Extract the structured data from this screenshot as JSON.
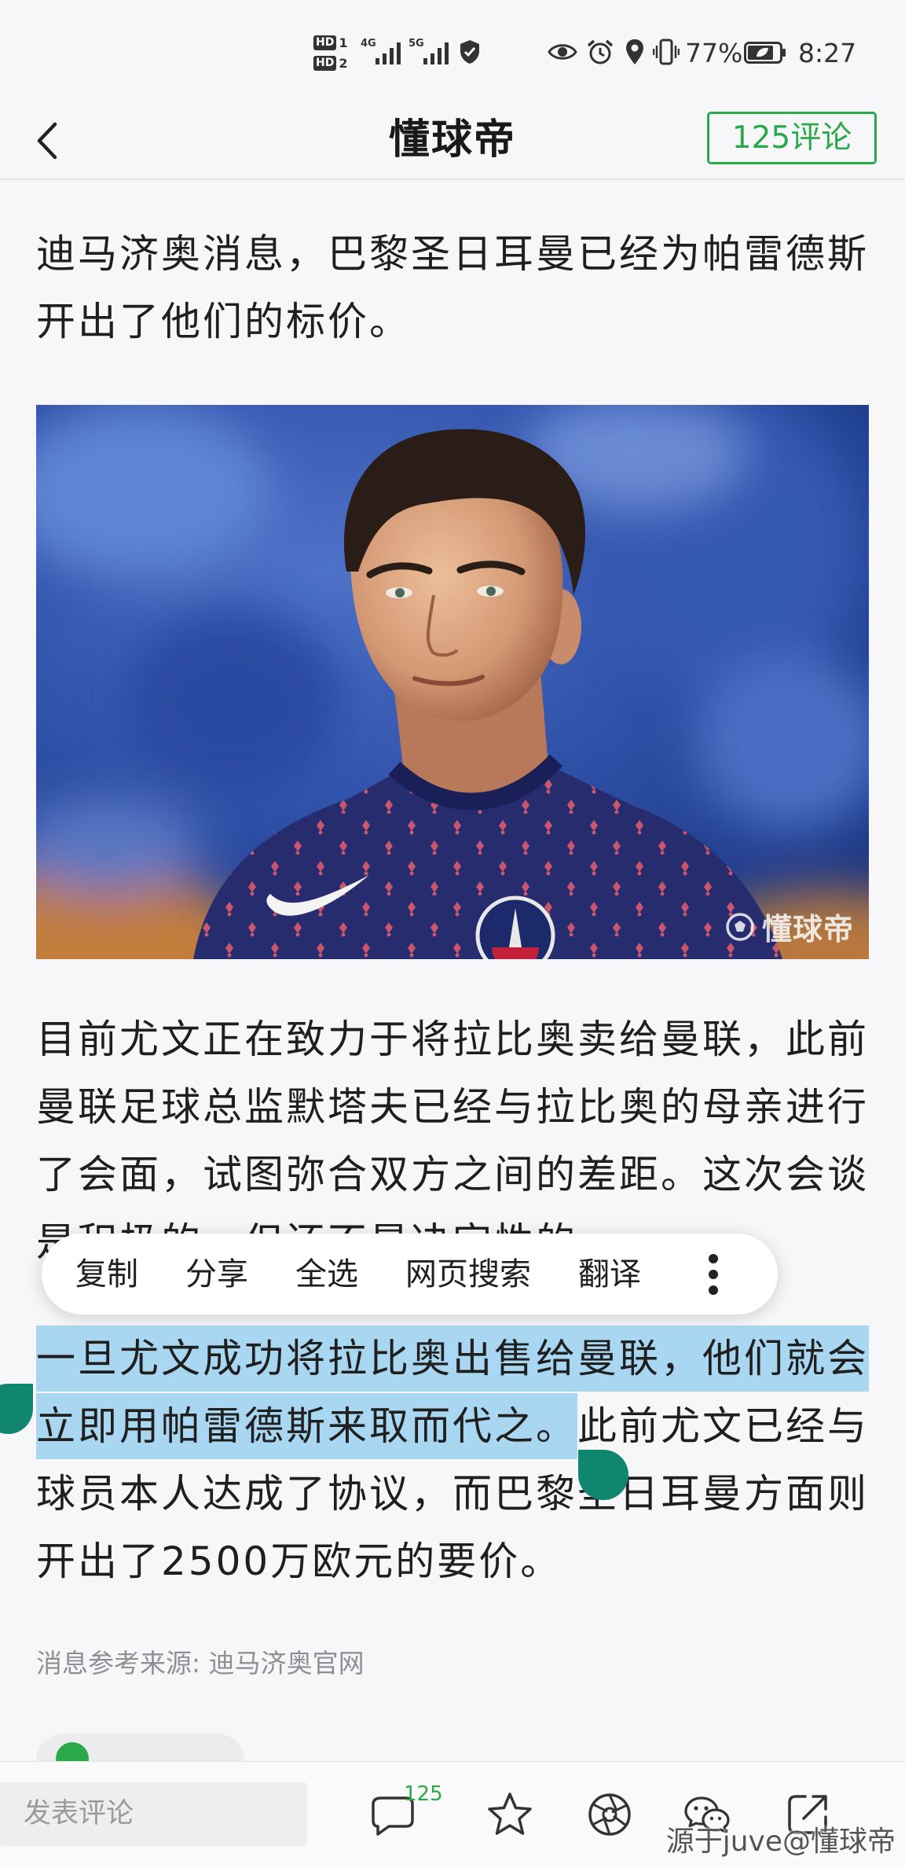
{
  "status_bar": {
    "sim_cards": [
      {
        "badge": "HD",
        "slot": "1"
      },
      {
        "badge": "HD",
        "slot": "2"
      }
    ],
    "networks": [
      "4G",
      "5G"
    ],
    "battery_percent": "77%",
    "time": "8:27",
    "icons": [
      "signal-4g-icon",
      "signal-5g-icon",
      "shield-check-icon",
      "eye-icon",
      "alarm-icon",
      "location-icon",
      "vibrate-icon",
      "battery-saver-icon"
    ]
  },
  "header": {
    "title": "懂球帝",
    "comments_button": "125评论",
    "icons": [
      "back-chevron-icon"
    ]
  },
  "article": {
    "intro": "迪马济奥消息，巴黎圣日耳曼已经为帕雷德斯开出了他们的标价。",
    "photo": {
      "watermark": "懂球帝",
      "icons": [
        "dongqiudi-logo-icon"
      ]
    },
    "body": "目前尤文正在致力于将拉比奥卖给曼联，此前曼联足球总监默塔夫已经与拉比奥的母亲进行了会面，试图弥合双方之间的差距。这次会谈是积极的，但还不是决定性的",
    "selection": {
      "selected_text": "一旦尤文成功将拉比奥出售给曼联，他们就会立即用帕雷德斯来取而代之。",
      "after_selection": "此前尤文已经与球员本人达成了协议，而巴黎圣日耳曼方面则开出了2500万欧元的要价。"
    },
    "source": "消息参考来源: 迪马济奥官网",
    "tag_icon": "green-circle-icon"
  },
  "context_menu": {
    "items": [
      {
        "label": "复制"
      },
      {
        "label": "分享"
      },
      {
        "label": "全选"
      },
      {
        "label": "网页搜索"
      },
      {
        "label": "翻译"
      }
    ],
    "more_icon": "more-vertical-icon"
  },
  "bottom_bar": {
    "comment_placeholder": "发表评论",
    "comment_count": "125",
    "icons": [
      "comment-icon",
      "star-icon",
      "aperture-icon",
      "wechat-icon",
      "share-icon"
    ]
  },
  "overlay_watermark": "源于juve@懂球帝",
  "colors": {
    "accent": "#2aa94a",
    "selection": "#a9d7f1",
    "selection_handle": "#10866f",
    "page_background": "#f7f7f9"
  }
}
